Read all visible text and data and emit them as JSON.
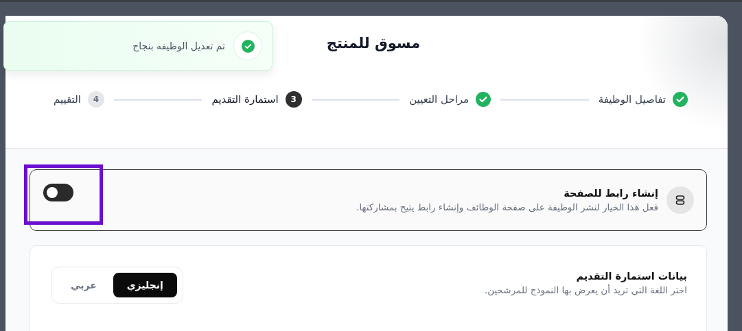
{
  "toast": {
    "message": "تم تعديل الوظيفه بنجاح"
  },
  "modal": {
    "title": "مسوق للمنتج"
  },
  "steps": [
    {
      "label": "تفاصيل الوظيفة",
      "completed": true,
      "selected": false
    },
    {
      "label": "مراحل التعيين",
      "completed": true,
      "selected": false
    },
    {
      "label": "استمارة التقديم",
      "completed": false,
      "selected": true,
      "number": "3"
    },
    {
      "label": "التقييم",
      "completed": false,
      "selected": false,
      "number": "4"
    }
  ],
  "page_link": {
    "title": "إنشاء رابط للصفحة",
    "description": "فعل هذا الخيار لنشر الوظيفة على صفحة الوظائف وإنشاء رابط يتيح بمشاركتها.",
    "on": false,
    "highlighted": true
  },
  "form_language": {
    "title": "بيانات استمارة التقديم",
    "description": "اختر اللغة التي تريد أن يعرض بها النموذج للمرشحين.",
    "options": [
      {
        "label": "إنجليزي",
        "selected": true
      },
      {
        "label": "عربي",
        "selected": false
      }
    ]
  }
}
